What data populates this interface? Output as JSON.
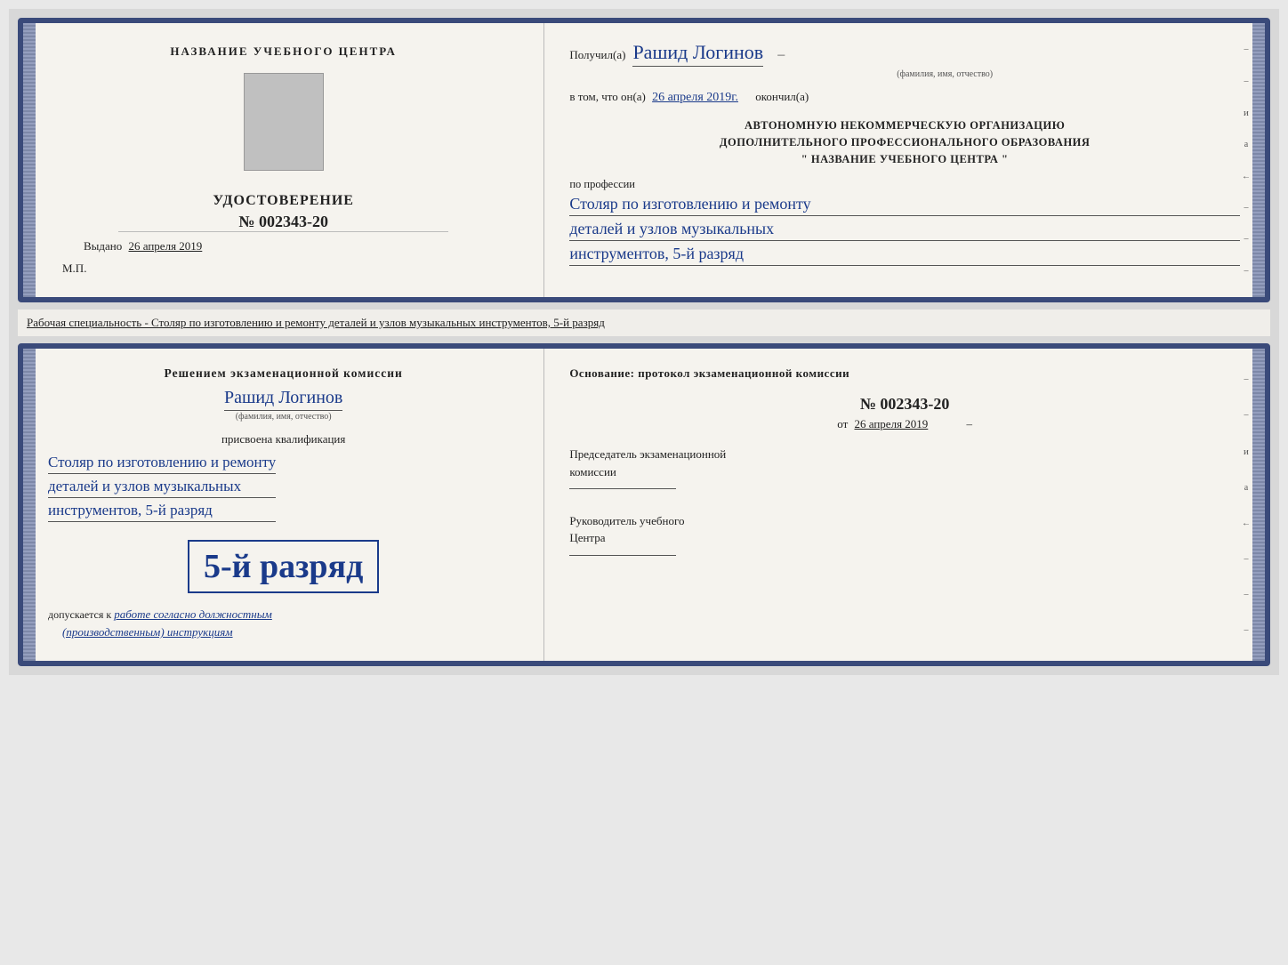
{
  "card1": {
    "left": {
      "center_title": "НАЗВАНИЕ УЧЕБНОГО ЦЕНТРА",
      "cert_type": "УДОСТОВЕРЕНИЕ",
      "cert_number": "№ 002343-20",
      "issued_label": "Выдано",
      "issued_date": "26 апреля 2019",
      "mp_label": "М.П."
    },
    "right": {
      "received_label": "Получил(а)",
      "name_handwritten": "Рашид Логинов",
      "name_subtitle": "(фамилия, имя, отчество)",
      "date_line_prefix": "в том, что он(а)",
      "date_handwritten": "26 апреля 2019г.",
      "completed_label": "окончил(а)",
      "org_line1": "АВТОНОМНУЮ НЕКОММЕРЧЕСКУЮ ОРГАНИЗАЦИЮ",
      "org_line2": "ДОПОЛНИТЕЛЬНОГО ПРОФЕССИОНАЛЬНОГО ОБРАЗОВАНИЯ",
      "org_line3": "\"   НАЗВАНИЕ УЧЕБНОГО ЦЕНТРА   \"",
      "profession_label": "по профессии",
      "profession_line1": "Столяр по изготовлению и ремонту",
      "profession_line2": "деталей и узлов музыкальных",
      "profession_line3": "инструментов, 5-й разряд"
    }
  },
  "separator": {
    "text": "Рабочая специальность - Столяр по изготовлению и ремонту деталей и узлов музыкальных инструментов, 5-й разряд"
  },
  "card2": {
    "left": {
      "commission_text": "Решением экзаменационной комиссии",
      "name_handwritten": "Рашид Логинов",
      "name_subtitle": "(фамилия, имя, отчество)",
      "qualification_assigned": "присвоена квалификация",
      "profession_line1": "Столяр по изготовлению и ремонту",
      "profession_line2": "деталей и узлов музыкальных",
      "profession_line3": "инструментов, 5-й разряд",
      "big_rank": "5-й разряд",
      "допускается_prefix": "допускается к",
      "допускается_text": "работе согласно должностным",
      "допускается_text2": "(производственным) инструкциям"
    },
    "right": {
      "osnov_label": "Основание: протокол экзаменационной комиссии",
      "protocol_number": "№  002343-20",
      "from_prefix": "от",
      "from_date": "26 апреля 2019",
      "chairman_label": "Председатель экзаменационной",
      "chairman_label2": "комиссии",
      "руководитель_label": "Руководитель учебного",
      "руководитель_label2": "Центра"
    }
  }
}
